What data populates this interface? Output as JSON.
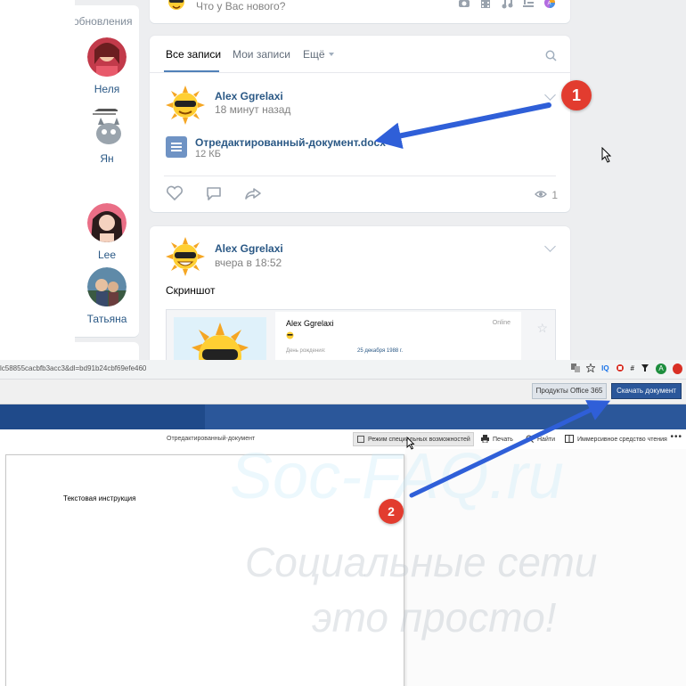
{
  "vk": {
    "friends_title": "обновления",
    "friends": [
      {
        "name": "Неля"
      },
      {
        "name": "Ян"
      },
      {
        "name": "Lee"
      },
      {
        "name": "Татьяна"
      }
    ],
    "composer_placeholder": "Что у Вас нового?",
    "tabs": [
      {
        "label": "Все записи",
        "active": true
      },
      {
        "label": "Мои записи",
        "active": false
      },
      {
        "label": "Ещё",
        "active": false
      }
    ],
    "post1": {
      "author": "Alex Ggrelaxi",
      "time": "18 минут назад",
      "doc_name": "Отредактированный-документ.docx",
      "doc_size": "12 КБ",
      "views": "1"
    },
    "post2": {
      "author": "Alex Ggrelaxi",
      "time": "вчера в 18:52",
      "text": "Скриншот",
      "shot_name": "Alex Ggrelaxi",
      "shot_online": "Online",
      "shot_dob_label": "День рождения:",
      "shot_dob_value": "25 декабря 1988 г."
    }
  },
  "office": {
    "url": "lc58855cacbfb3acc3&dl=bd91b24cbf69efe460",
    "ext_a": "A",
    "products_button": "Продукты Office 365",
    "download_button": "Скачать документ",
    "doc_title": "Отредактированный-документ",
    "accessibility_button": "Режим специальных возможностей",
    "print_button": "Печать",
    "find_button": "Найти",
    "immersive_button": "Иммерсивное средство чтения",
    "page_text": "Текстовая инструкция"
  },
  "watermark": {
    "line1": "Soc-FAQ.ru",
    "line2": "Социальные сети",
    "line3": "это просто!"
  },
  "annotations": {
    "badge1": "1",
    "badge2": "2",
    "arrow_color": "#2f5fd8",
    "badge_color": "#e23c2f"
  },
  "colors": {
    "vk_link": "#2a5885",
    "vk_bg": "#edeef0",
    "office_blue": "#2b579a"
  }
}
